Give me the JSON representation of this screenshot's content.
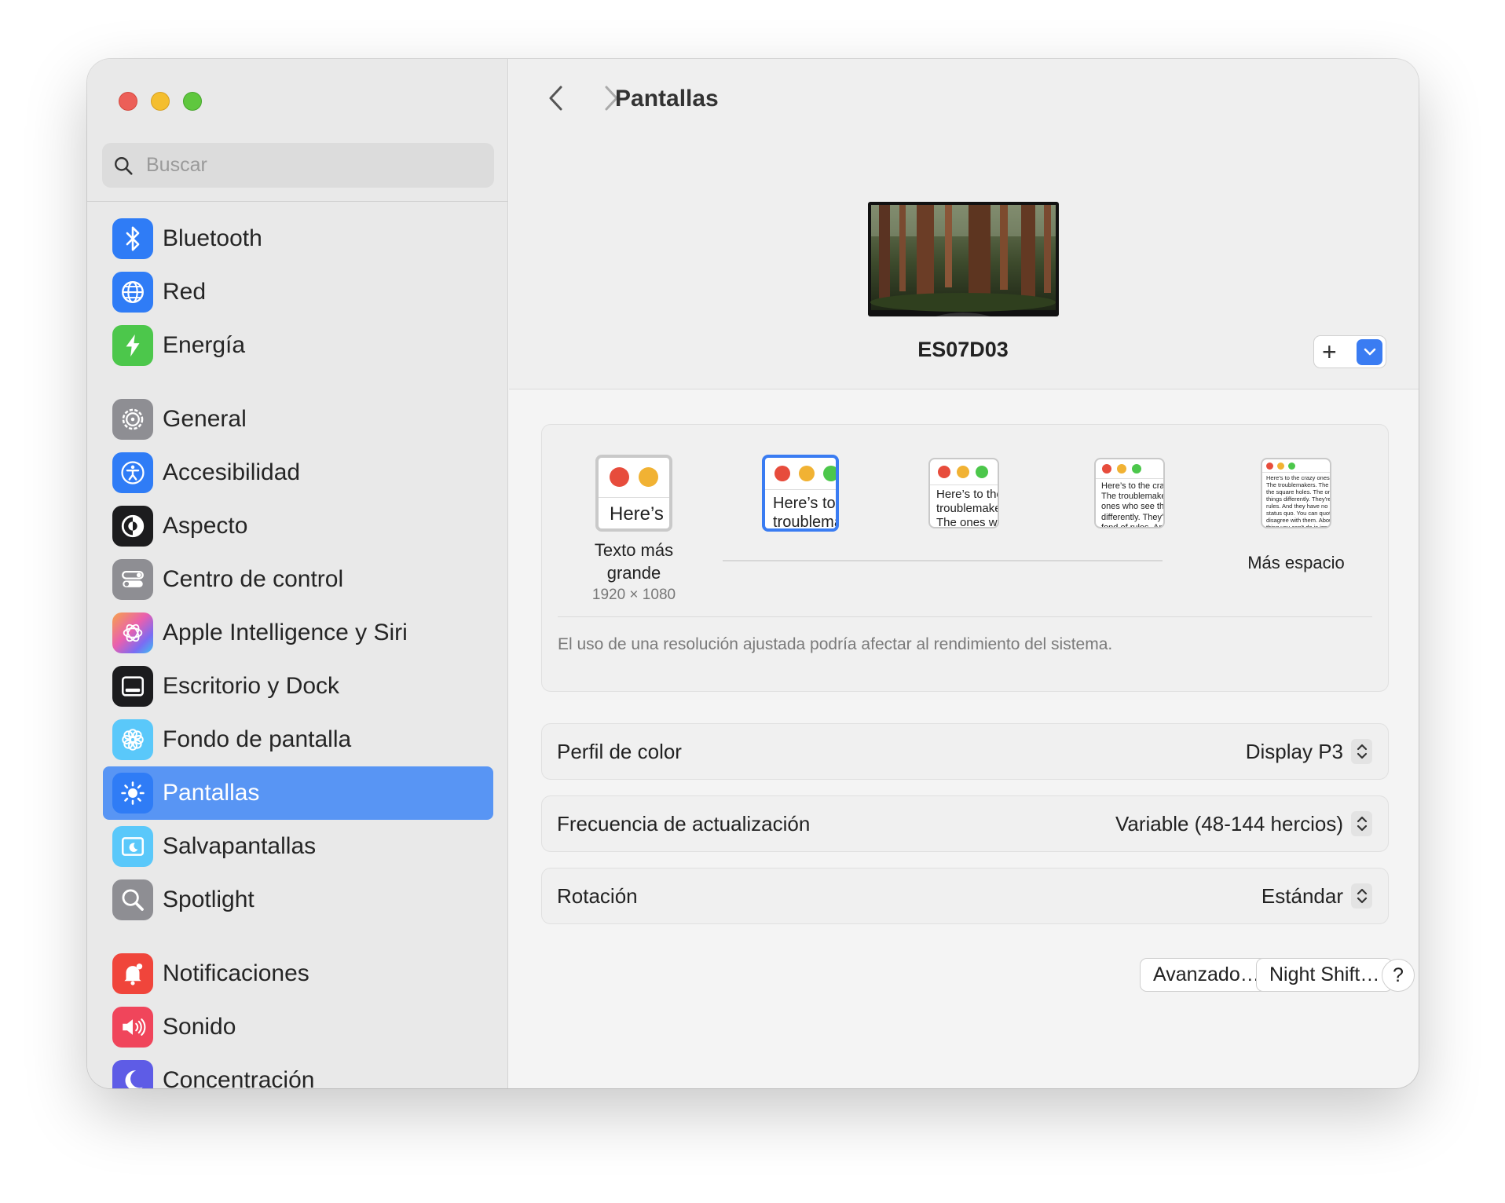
{
  "window": {
    "title": "Pantallas"
  },
  "search": {
    "placeholder": "Buscar"
  },
  "sidebar": {
    "items": [
      {
        "label": "Bluetooth",
        "icon": "bluetooth-icon",
        "color": "#2f7cf6"
      },
      {
        "label": "Red",
        "icon": "globe-icon",
        "color": "#2f7cf6"
      },
      {
        "label": "Energía",
        "icon": "bolt-icon",
        "color": "#4cc74b"
      },
      {
        "label": "General",
        "icon": "gear-icon",
        "color": "#8e8e93"
      },
      {
        "label": "Accesibilidad",
        "icon": "accessibility-icon",
        "color": "#2f7cf6"
      },
      {
        "label": "Aspecto",
        "icon": "appearance-icon",
        "color": "#1c1c1e"
      },
      {
        "label": "Centro de control",
        "icon": "control-center-icon",
        "color": "#8e8e93"
      },
      {
        "label": "Apple Intelligence y Siri",
        "icon": "siri-icon",
        "color": "#d35bd3"
      },
      {
        "label": "Escritorio y Dock",
        "icon": "dock-icon",
        "color": "#1c1c1e"
      },
      {
        "label": "Fondo de pantalla",
        "icon": "wallpaper-icon",
        "color": "#5ac8fa"
      },
      {
        "label": "Pantallas",
        "icon": "sun-icon",
        "color": "#2f7cf6",
        "active": true
      },
      {
        "label": "Salvapantallas",
        "icon": "screensaver-icon",
        "color": "#5ac8fa"
      },
      {
        "label": "Spotlight",
        "icon": "magnifier-icon",
        "color": "#8e8e93"
      },
      {
        "label": "Notificaciones",
        "icon": "bell-icon",
        "color": "#f0453b"
      },
      {
        "label": "Sonido",
        "icon": "speaker-icon",
        "color": "#f0455b"
      },
      {
        "label": "Concentración",
        "icon": "moon-icon",
        "color": "#5e5ce6"
      }
    ]
  },
  "display": {
    "name": "ES07D03",
    "add_symbol": "+"
  },
  "resolution": {
    "options": [
      {
        "label": "Texto más grande",
        "sublabel": "1920 × 1080",
        "preview_text": "Here’s",
        "selected": false
      },
      {
        "label": "",
        "preview_text": "Here’s to the troublemakers",
        "selected": true
      },
      {
        "label": "",
        "preview_text": "Here’s to the troublemakers. The ones who",
        "selected": false
      },
      {
        "label": "",
        "preview_text": "Here’s to the crazy ones. The troublemakers. The ones who see things differently. They're not fond of rules. And they",
        "selected": false
      },
      {
        "label": "Más espacio",
        "preview_text": "Here’s to the crazy ones. The misfits. The troublemakers. The round pegs in the square holes. The ones who see things differently. They're not fond of rules. And they have no respect for the status quo. You can quote them, disagree with them. About the only thing you can't do is ignore them. Because they change things.",
        "selected": false
      }
    ],
    "note": "El uso de una resolución ajustada podría afectar al rendimiento del sistema."
  },
  "settings": {
    "color_profile": {
      "label": "Perfil de color",
      "value": "Display P3"
    },
    "refresh_rate": {
      "label": "Frecuencia de actualización",
      "value": "Variable (48-144 hercios)"
    },
    "rotation": {
      "label": "Rotación",
      "value": "Estándar"
    }
  },
  "buttons": {
    "advanced": "Avanzado…",
    "night_shift": "Night Shift…",
    "help": "?"
  },
  "colors": {
    "accent": "#3a7cf2",
    "selection": "#5895f4"
  }
}
